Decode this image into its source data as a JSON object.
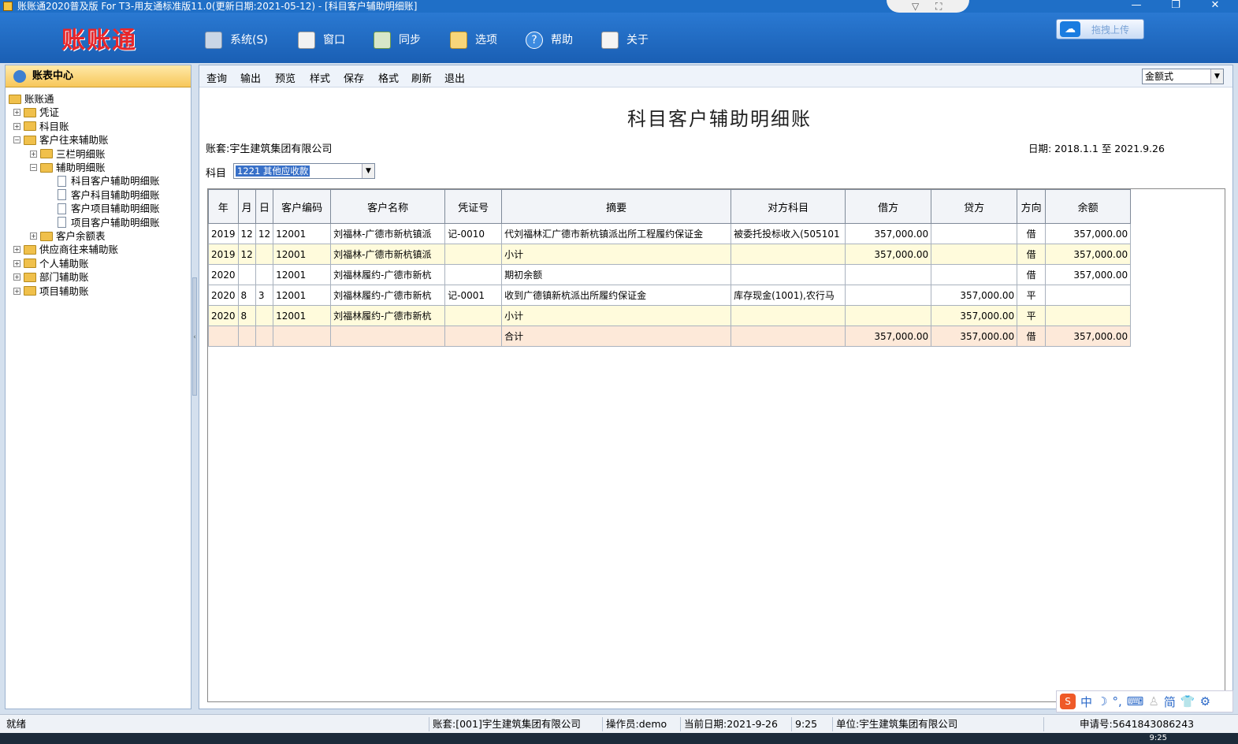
{
  "window": {
    "title": "账账通2020普及版 For T3-用友通标准版11.0(更新日期:2021-05-12) - [科目客户辅助明细账]",
    "minimize": "—",
    "restore": "❐",
    "close": "✕"
  },
  "header": {
    "logo": "账账通",
    "menu": [
      {
        "label": "系统(S)",
        "icon": "system-icon"
      },
      {
        "label": "窗口",
        "icon": "window-icon"
      },
      {
        "label": "同步",
        "icon": "sync-icon"
      },
      {
        "label": "选项",
        "icon": "options-icon"
      },
      {
        "label": "帮助",
        "icon": "help-icon"
      },
      {
        "label": "关于",
        "icon": "about-icon"
      }
    ],
    "upload_label": "拖拽上传"
  },
  "sidebar": {
    "title": "账表中心",
    "tree": [
      {
        "label": "账账通",
        "level": 0,
        "type": "folder",
        "exp": ""
      },
      {
        "label": "凭证",
        "level": 1,
        "type": "folder",
        "exp": "+"
      },
      {
        "label": "科目账",
        "level": 1,
        "type": "folder",
        "exp": "+"
      },
      {
        "label": "客户往来辅助账",
        "level": 1,
        "type": "folder",
        "exp": "−"
      },
      {
        "label": "三栏明细账",
        "level": 2,
        "type": "folder",
        "exp": "+"
      },
      {
        "label": "辅助明细账",
        "level": 2,
        "type": "folder",
        "exp": "−"
      },
      {
        "label": "科目客户辅助明细账",
        "level": 3,
        "type": "doc",
        "exp": ""
      },
      {
        "label": "客户科目辅助明细账",
        "level": 3,
        "type": "doc",
        "exp": ""
      },
      {
        "label": "客户项目辅助明细账",
        "level": 3,
        "type": "doc",
        "exp": ""
      },
      {
        "label": "项目客户辅助明细账",
        "level": 3,
        "type": "doc",
        "exp": ""
      },
      {
        "label": "客户余额表",
        "level": 2,
        "type": "folder",
        "exp": "+"
      },
      {
        "label": "供应商往来辅助账",
        "level": 1,
        "type": "folder",
        "exp": "+"
      },
      {
        "label": "个人辅助账",
        "level": 1,
        "type": "folder",
        "exp": "+"
      },
      {
        "label": "部门辅助账",
        "level": 1,
        "type": "folder",
        "exp": "+"
      },
      {
        "label": "项目辅助账",
        "level": 1,
        "type": "folder",
        "exp": "+"
      }
    ]
  },
  "toolbar": {
    "items": [
      "查询",
      "输出",
      "预览",
      "样式",
      "保存",
      "格式",
      "刷新",
      "退出"
    ],
    "format_value": "金额式"
  },
  "report": {
    "title": "科目客户辅助明细账",
    "account": "账套:宇生建筑集团有限公司",
    "date": "日期: 2018.1.1 至 2021.9.26",
    "subject_label": "科目",
    "subject_value": "1221 其他应收款",
    "columns": [
      "年",
      "月",
      "日",
      "客户编码",
      "客户名称",
      "凭证号",
      "摘要",
      "对方科目",
      "借方",
      "贷方",
      "方向",
      "余额"
    ],
    "rows": [
      {
        "kind": "normal",
        "cells": [
          "2019",
          "12",
          "12",
          "12001",
          "刘福林-广德市新杭镇派",
          "记-0010",
          "代刘福林汇广德市新杭镇派出所工程履约保证金",
          "被委托投标收入(505101",
          "357,000.00",
          "",
          "借",
          "357,000.00"
        ]
      },
      {
        "kind": "subtotal",
        "cells": [
          "2019",
          "12",
          "",
          "12001",
          "刘福林-广德市新杭镇派",
          "",
          "小计",
          "",
          "357,000.00",
          "",
          "借",
          "357,000.00"
        ]
      },
      {
        "kind": "normal",
        "cells": [
          "2020",
          "",
          "",
          "12001",
          "刘福林履约-广德市新杭",
          "",
          "期初余额",
          "",
          "",
          "",
          "借",
          "357,000.00"
        ]
      },
      {
        "kind": "normal",
        "cells": [
          "2020",
          "8",
          "3",
          "12001",
          "刘福林履约-广德市新杭",
          "记-0001",
          "收到广德镇新杭派出所履约保证金",
          "库存现金(1001),农行马",
          "",
          "357,000.00",
          "平",
          ""
        ]
      },
      {
        "kind": "subtotal",
        "cells": [
          "2020",
          "8",
          "",
          "12001",
          "刘福林履约-广德市新杭",
          "",
          "小计",
          "",
          "",
          "357,000.00",
          "平",
          ""
        ]
      },
      {
        "kind": "total",
        "cells": [
          "",
          "",
          "",
          "",
          "",
          "",
          "合计",
          "",
          "357,000.00",
          "357,000.00",
          "借",
          "357,000.00"
        ]
      }
    ]
  },
  "statusbar": {
    "state": "就绪",
    "account": "账套:[001]宇生建筑集团有限公司",
    "operator": "操作员:demo",
    "current_date": "当前日期:2021-9-26",
    "time": "9:25",
    "unit": "单位:宇生建筑集团有限公司",
    "serial": "申请号:5641843086243"
  },
  "ime": {
    "mode": "中",
    "simplified": "简"
  },
  "taskbar": {
    "clock": "9:25"
  }
}
